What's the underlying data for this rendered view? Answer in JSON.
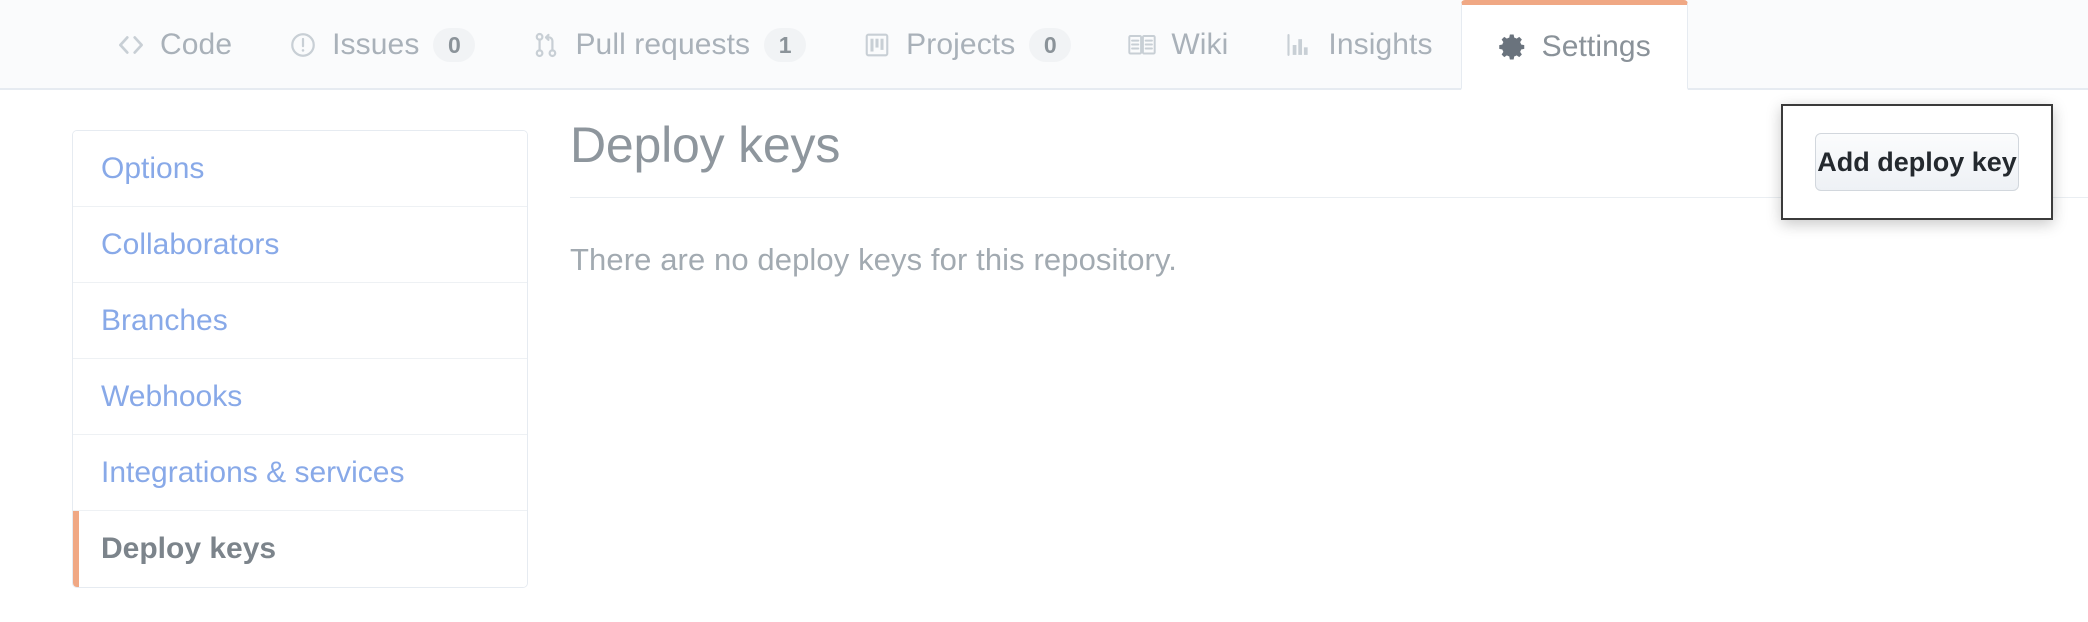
{
  "repo_nav": {
    "tabs": [
      {
        "label": "Code",
        "icon": "code-icon",
        "count": null,
        "selected": false
      },
      {
        "label": "Issues",
        "icon": "issue-opened-icon",
        "count": "0",
        "selected": false
      },
      {
        "label": "Pull requests",
        "icon": "git-pull-request-icon",
        "count": "1",
        "selected": false
      },
      {
        "label": "Projects",
        "icon": "project-board-icon",
        "count": "0",
        "selected": false
      },
      {
        "label": "Wiki",
        "icon": "book-icon",
        "count": null,
        "selected": false
      },
      {
        "label": "Insights",
        "icon": "graph-icon",
        "count": null,
        "selected": false
      },
      {
        "label": "Settings",
        "icon": "gear-icon",
        "count": null,
        "selected": true
      }
    ],
    "active_accent_color": "#f0a884"
  },
  "sidebar": {
    "items": [
      {
        "label": "Options",
        "selected": false
      },
      {
        "label": "Collaborators",
        "selected": false
      },
      {
        "label": "Branches",
        "selected": false
      },
      {
        "label": "Webhooks",
        "selected": false
      },
      {
        "label": "Integrations & services",
        "selected": false
      },
      {
        "label": "Deploy keys",
        "selected": true
      }
    ],
    "link_color": "#88a9e8",
    "selected_marker_color": "#f0a884"
  },
  "main": {
    "title": "Deploy keys",
    "empty_message": "There are no deploy keys for this repository.",
    "add_button_label": "Add deploy key",
    "highlight_border_color": "#3b3b3b"
  }
}
